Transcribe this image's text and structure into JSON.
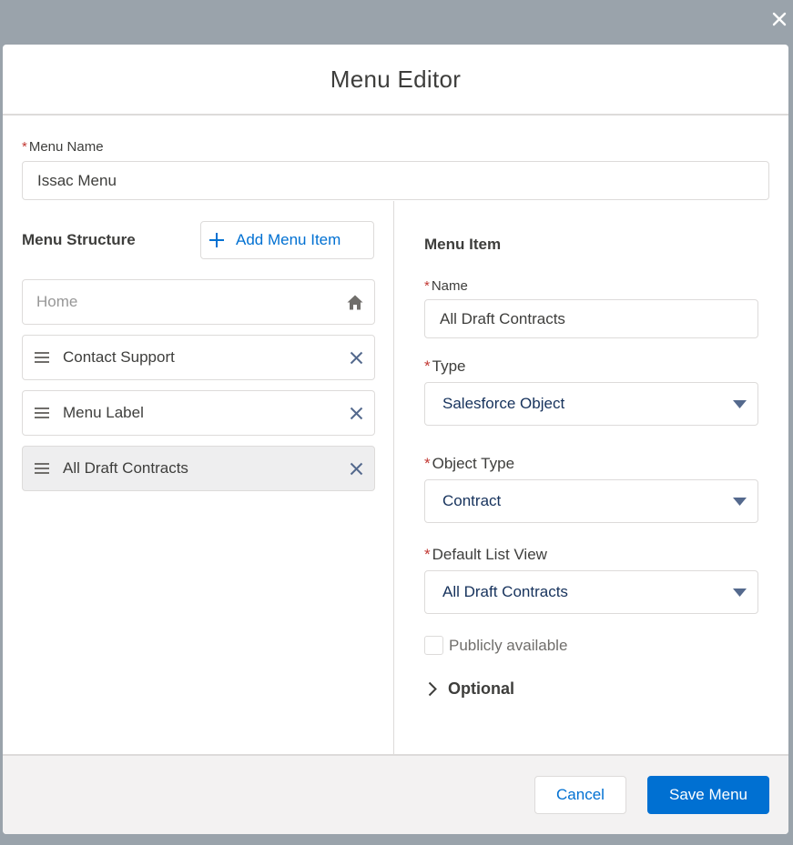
{
  "modal": {
    "title": "Menu Editor"
  },
  "menu_name": {
    "label": "Menu Name",
    "required_mark": "*",
    "value": "Issac Menu"
  },
  "structure": {
    "title": "Menu Structure",
    "add_label": "Add Menu Item",
    "items": [
      {
        "label": "Home",
        "icon": "home-icon"
      },
      {
        "label": "Contact Support"
      },
      {
        "label": "Menu Label"
      },
      {
        "label": "All Draft Contracts",
        "selected": true
      }
    ]
  },
  "menu_item": {
    "title": "Menu Item",
    "name": {
      "label": "Name",
      "value": "All Draft Contracts"
    },
    "type": {
      "label": "Type",
      "value": "Salesforce Object"
    },
    "object_type": {
      "label": "Object Type",
      "value": "Contract"
    },
    "default_list_view": {
      "label": "Default List View",
      "value": "All Draft Contracts"
    },
    "publicly_available": {
      "label": "Publicly available",
      "checked": false
    },
    "optional": {
      "label": "Optional"
    }
  },
  "footer": {
    "cancel_label": "Cancel",
    "save_label": "Save Menu"
  },
  "colors": {
    "brand": "#0070d2",
    "required": "#c23934",
    "border": "#dddbda"
  }
}
